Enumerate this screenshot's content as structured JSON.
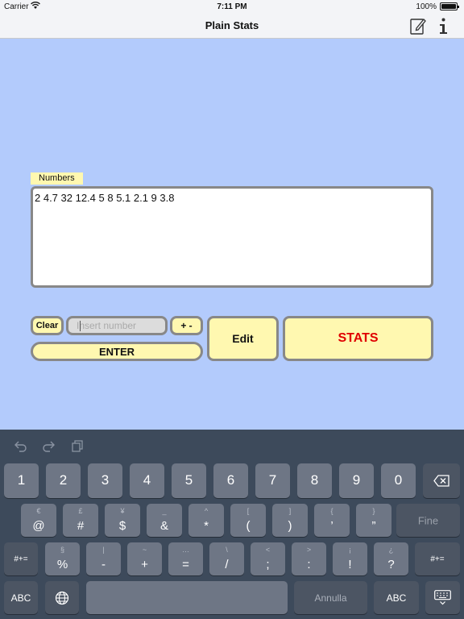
{
  "status_bar": {
    "carrier": "Carrier",
    "time": "7:11 PM",
    "battery": "100%"
  },
  "nav": {
    "title": "Plain Stats"
  },
  "numbers": {
    "label": "Numbers",
    "value": "2 4.7 32 12.4 5 8 5.1 2.1 9 3.8"
  },
  "controls": {
    "clear_label": "Clear",
    "input_placeholder": "Insert number",
    "plusminus_label": "+ -",
    "enter_label": "ENTER",
    "edit_label": "Edit",
    "stats_label": "STATS"
  },
  "keyboard": {
    "row1": [
      "1",
      "2",
      "3",
      "4",
      "5",
      "6",
      "7",
      "8",
      "9",
      "0"
    ],
    "row2": [
      {
        "main": "@",
        "alt": "€"
      },
      {
        "main": "#",
        "alt": "£"
      },
      {
        "main": "$",
        "alt": "¥"
      },
      {
        "main": "&",
        "alt": "_"
      },
      {
        "main": "*",
        "alt": "^"
      },
      {
        "main": "(",
        "alt": "["
      },
      {
        "main": ")",
        "alt": "]"
      },
      {
        "main": "’",
        "alt": "{"
      },
      {
        "main": "”",
        "alt": "}"
      }
    ],
    "row2_action": "Fine",
    "row3_left": "#+=",
    "row3": [
      {
        "main": "%",
        "alt": "§"
      },
      {
        "main": "-",
        "alt": "|"
      },
      {
        "main": "+",
        "alt": "~"
      },
      {
        "main": "=",
        "alt": "…"
      },
      {
        "main": "/",
        "alt": "\\"
      },
      {
        "main": ";",
        "alt": "<"
      },
      {
        "main": ":",
        "alt": ">"
      },
      {
        "main": "!",
        "alt": "¡"
      },
      {
        "main": "?",
        "alt": "¿"
      }
    ],
    "row3_right": "#+=",
    "row4_left": "ABC",
    "row4_action": "Annulla",
    "row4_right": "ABC"
  }
}
